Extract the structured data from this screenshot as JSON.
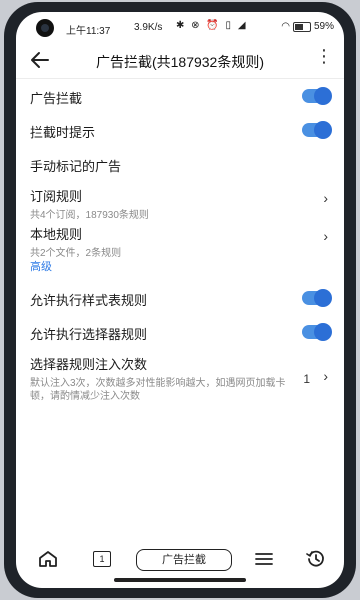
{
  "status": {
    "time": "上午11:37",
    "speed": "3.9K/s",
    "battery": "59%"
  },
  "header": {
    "title": "广告拦截(共187932条规则)",
    "more": "⋮"
  },
  "settings": {
    "ad_block": {
      "label": "广告拦截",
      "enabled": true
    },
    "block_tip": {
      "label": "拦截时提示",
      "enabled": true
    },
    "manual_mark": {
      "label": "手动标记的广告"
    },
    "subscriptions": {
      "label": "订阅规则",
      "sub": "共4个订阅，187930条规则"
    },
    "local_rules": {
      "label": "本地规则",
      "sub": "共2个文件，2条规则"
    },
    "advanced_section": "高级",
    "allow_stylesheet": {
      "label": "允许执行样式表规则",
      "enabled": true
    },
    "allow_selector": {
      "label": "允许执行选择器规则",
      "enabled": true
    },
    "selector_injection": {
      "label": "选择器规则注入次数",
      "sub": "默认注入3次，次数越多对性能影响越大，如遇网页加载卡顿，请酌情减少注入次数",
      "value": "1"
    }
  },
  "bottom_bar": {
    "tab_count": "1",
    "current_tab_label": "广告拦截"
  },
  "colors": {
    "accent": "#2f7be6",
    "toggle_on": "#4a90e2"
  }
}
